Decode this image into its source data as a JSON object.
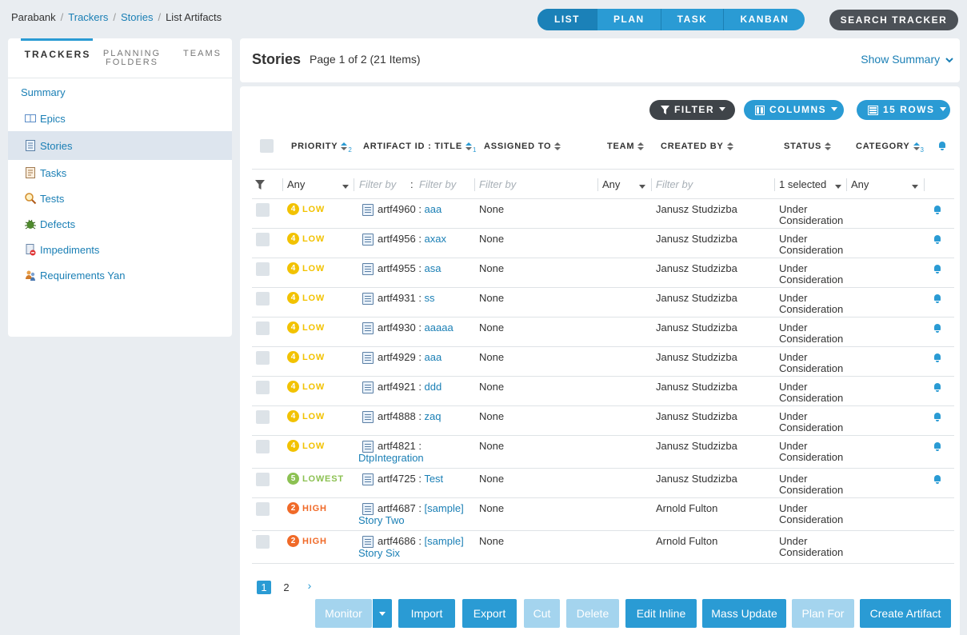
{
  "breadcrumb": [
    {
      "label": "Parabank",
      "link": false
    },
    {
      "label": "Trackers",
      "link": true
    },
    {
      "label": "Stories",
      "link": true
    },
    {
      "label": "List Artifacts",
      "link": false
    }
  ],
  "view_toggle": [
    "LIST",
    "PLAN",
    "TASK",
    "KANBAN"
  ],
  "search_tracker": "SEARCH TRACKER",
  "sidebar": {
    "tabs": [
      "TRACKERS",
      "PLANNING FOLDERS",
      "TEAMS"
    ],
    "summary": "Summary",
    "items": [
      {
        "label": "Epics",
        "icon": "epic-book-icon"
      },
      {
        "label": "Stories",
        "icon": "story-icon"
      },
      {
        "label": "Tasks",
        "icon": "task-icon"
      },
      {
        "label": "Tests",
        "icon": "test-magnifier-icon"
      },
      {
        "label": "Defects",
        "icon": "bug-icon"
      },
      {
        "label": "Impediments",
        "icon": "impediment-icon"
      },
      {
        "label": "Requirements Yan",
        "icon": "requirements-icon"
      }
    ]
  },
  "header": {
    "title": "Stories",
    "page_info": "Page 1 of 2 (21 Items)",
    "show_summary": "Show Summary"
  },
  "toolbar": {
    "filter": "FILTER",
    "columns": "COLUMNS",
    "rows": "15 ROWS"
  },
  "columns": {
    "priority": "PRIORITY",
    "priority_sort": "2",
    "artifact": "ARTIFACT ID : TITLE",
    "artifact_sort": "1",
    "assigned": "ASSIGNED TO",
    "team": "TEAM",
    "created_by": "CREATED BY",
    "status": "STATUS",
    "category": "CATEGORY",
    "category_sort": "3"
  },
  "filters": {
    "priority": "Any",
    "artifact_id": "Filter by",
    "title": "Filter by",
    "assigned": "Filter by",
    "team": "Any",
    "created_by": "Filter by",
    "status": "1 selected",
    "category": "Any"
  },
  "rows": [
    {
      "prio_num": "4",
      "prio": "LOW",
      "prio_color": "#f2c200",
      "id": "artf4960",
      "title": "aaa",
      "assigned": "None",
      "creator": "Janusz Studzizba",
      "status_l1": "Under",
      "status_l2": "Consideration",
      "bell": true
    },
    {
      "prio_num": "4",
      "prio": "LOW",
      "prio_color": "#f2c200",
      "id": "artf4956",
      "title": "axax",
      "assigned": "None",
      "creator": "Janusz Studzizba",
      "status_l1": "Under",
      "status_l2": "Consideration",
      "bell": true
    },
    {
      "prio_num": "4",
      "prio": "LOW",
      "prio_color": "#f2c200",
      "id": "artf4955",
      "title": "asa",
      "assigned": "None",
      "creator": "Janusz Studzizba",
      "status_l1": "Under",
      "status_l2": "Consideration",
      "bell": true
    },
    {
      "prio_num": "4",
      "prio": "LOW",
      "prio_color": "#f2c200",
      "id": "artf4931",
      "title": "ss",
      "assigned": "None",
      "creator": "Janusz Studzizba",
      "status_l1": "Under",
      "status_l2": "Consideration",
      "bell": true
    },
    {
      "prio_num": "4",
      "prio": "LOW",
      "prio_color": "#f2c200",
      "id": "artf4930",
      "title": "aaaaa",
      "assigned": "None",
      "creator": "Janusz Studzizba",
      "status_l1": "Under",
      "status_l2": "Consideration",
      "bell": true
    },
    {
      "prio_num": "4",
      "prio": "LOW",
      "prio_color": "#f2c200",
      "id": "artf4929",
      "title": "aaa",
      "assigned": "None",
      "creator": "Janusz Studzizba",
      "status_l1": "Under",
      "status_l2": "Consideration",
      "bell": true
    },
    {
      "prio_num": "4",
      "prio": "LOW",
      "prio_color": "#f2c200",
      "id": "artf4921",
      "title": "ddd",
      "assigned": "None",
      "creator": "Janusz Studzizba",
      "status_l1": "Under",
      "status_l2": "Consideration",
      "bell": true
    },
    {
      "prio_num": "4",
      "prio": "LOW",
      "prio_color": "#f2c200",
      "id": "artf4888",
      "title": "zaq",
      "assigned": "None",
      "creator": "Janusz Studzizba",
      "status_l1": "Under",
      "status_l2": "Consideration",
      "bell": true
    },
    {
      "prio_num": "4",
      "prio": "LOW",
      "prio_color": "#f2c200",
      "id": "artf4821",
      "title": "DtpIntegration",
      "assigned": "None",
      "creator": "Janusz Studzizba",
      "status_l1": "Under",
      "status_l2": "Consideration",
      "bell": true,
      "wrap": true
    },
    {
      "prio_num": "5",
      "prio": "LOWEST",
      "prio_color": "#8cc152",
      "id": "artf4725",
      "title": "Test",
      "assigned": "None",
      "creator": "Janusz Studzizba",
      "status_l1": "Under",
      "status_l2": "Consideration",
      "bell": true
    },
    {
      "prio_num": "2",
      "prio": "HIGH",
      "prio_color": "#f06a28",
      "id": "artf4687",
      "title_a": "[sample]",
      "title_b": "Story Two",
      "assigned": "None",
      "creator": "Arnold Fulton",
      "status_l1": "Under",
      "status_l2": "Consideration",
      "bell": false,
      "split": true
    },
    {
      "prio_num": "2",
      "prio": "HIGH",
      "prio_color": "#f06a28",
      "id": "artf4686",
      "title_a": "[sample]",
      "title_b": "Story Six",
      "assigned": "None",
      "creator": "Arnold Fulton",
      "status_l1": "Under",
      "status_l2": "Consideration",
      "bell": false,
      "split": true
    }
  ],
  "pagination": {
    "page1": "1",
    "page2": "2",
    "next": "›"
  },
  "buttons": {
    "monitor": "Monitor",
    "import": "Import",
    "export": "Export",
    "cut": "Cut",
    "delete": "Delete",
    "edit_inline": "Edit Inline",
    "mass_update": "Mass Update",
    "plan_for": "Plan For",
    "create_artifact": "Create Artifact"
  }
}
